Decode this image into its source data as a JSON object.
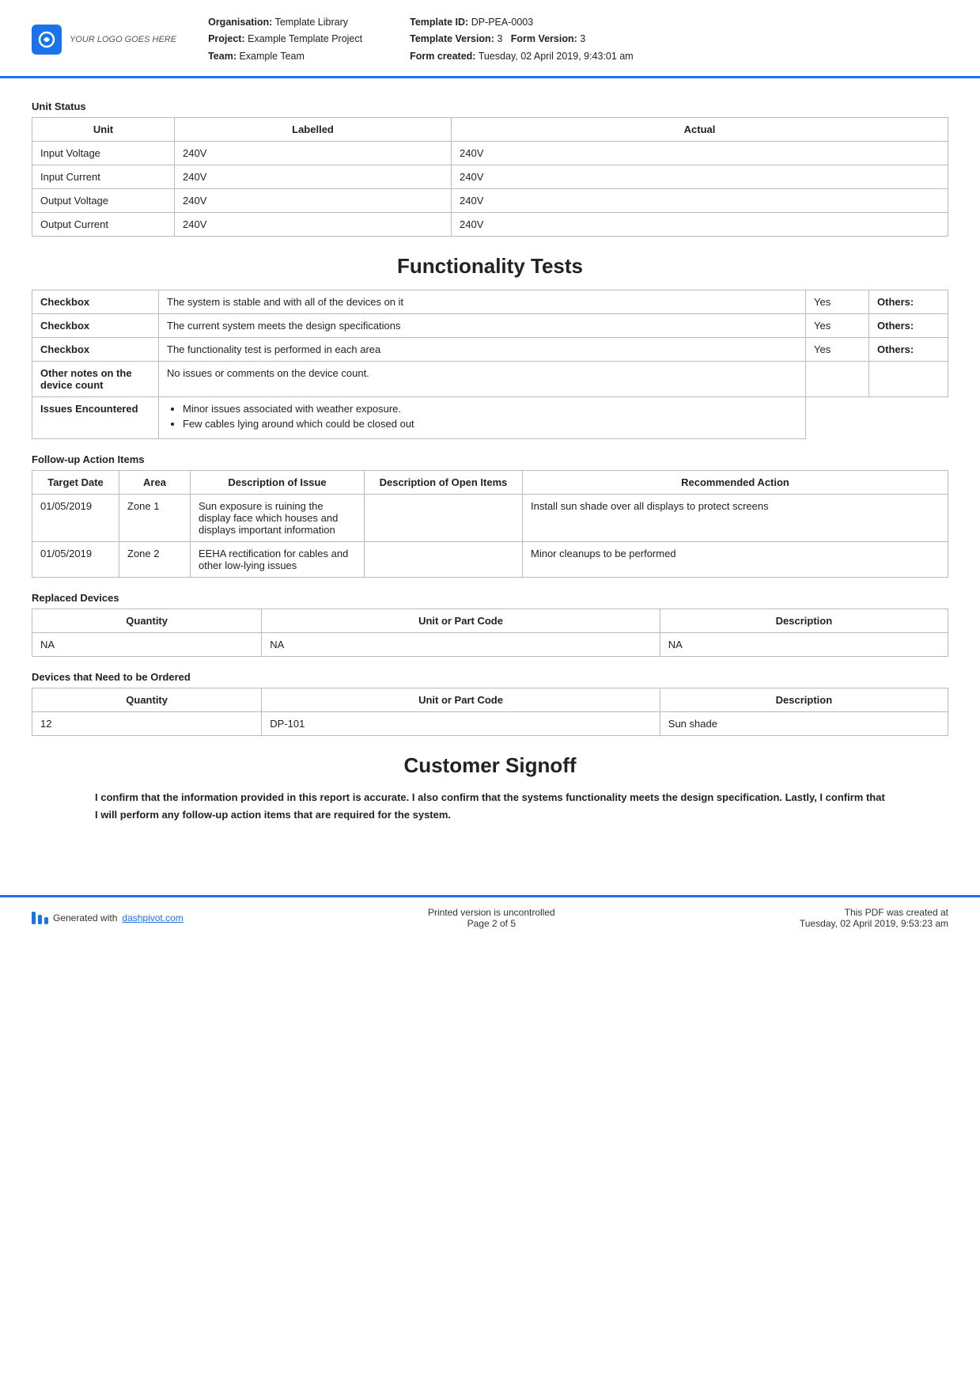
{
  "header": {
    "logo_text": "YOUR LOGO GOES HERE",
    "org_label": "Organisation:",
    "org_value": "Template Library",
    "project_label": "Project:",
    "project_value": "Example Template Project",
    "team_label": "Team:",
    "team_value": "Example Team",
    "template_id_label": "Template ID:",
    "template_id_value": "DP-PEA-0003",
    "template_version_label": "Template Version:",
    "template_version_value": "3",
    "form_version_label": "Form Version:",
    "form_version_value": "3",
    "form_created_label": "Form created:",
    "form_created_value": "Tuesday, 02 April 2019, 9:43:01 am"
  },
  "unit_status": {
    "section_label": "Unit Status",
    "columns": [
      "Unit",
      "Labelled",
      "Actual"
    ],
    "rows": [
      [
        "Input Voltage",
        "240V",
        "240V"
      ],
      [
        "Input Current",
        "240V",
        "240V"
      ],
      [
        "Output Voltage",
        "240V",
        "240V"
      ],
      [
        "Output Current",
        "240V",
        "240V"
      ]
    ]
  },
  "functionality_tests": {
    "heading": "Functionality Tests",
    "rows": [
      {
        "label": "Checkbox",
        "description": "The system is stable and with all of the devices on it",
        "value": "Yes",
        "others_label": "Others:"
      },
      {
        "label": "Checkbox",
        "description": "The current system meets the design specifications",
        "value": "Yes",
        "others_label": "Others:"
      },
      {
        "label": "Checkbox",
        "description": "The functionality test is performed in each area",
        "value": "Yes",
        "others_label": "Others:"
      },
      {
        "label": "Other notes on the device count",
        "description": "No issues or comments on the device count.",
        "value": "",
        "others_label": ""
      },
      {
        "label": "Issues Encountered",
        "description": "",
        "value": "",
        "others_label": "",
        "is_bullets": true,
        "bullets": [
          "Minor issues associated with weather exposure.",
          "Few cables lying around which could be closed out"
        ]
      }
    ]
  },
  "followup": {
    "section_label": "Follow-up Action Items",
    "columns": [
      "Target Date",
      "Area",
      "Description of Issue",
      "Description of Open Items",
      "Recommended Action"
    ],
    "rows": [
      {
        "target_date": "01/05/2019",
        "area": "Zone 1",
        "description": "Sun exposure is ruining the display face which houses and displays important information",
        "open_items": "",
        "recommended": "Install sun shade over all displays to protect screens"
      },
      {
        "target_date": "01/05/2019",
        "area": "Zone 2",
        "description": "EEHA rectification for cables and other low-lying issues",
        "open_items": "",
        "recommended": "Minor cleanups to be performed"
      }
    ]
  },
  "replaced_devices": {
    "section_label": "Replaced Devices",
    "columns": [
      "Quantity",
      "Unit or Part Code",
      "Description"
    ],
    "rows": [
      [
        "NA",
        "NA",
        "NA"
      ]
    ]
  },
  "devices_to_order": {
    "section_label": "Devices that Need to be Ordered",
    "columns": [
      "Quantity",
      "Unit or Part Code",
      "Description"
    ],
    "rows": [
      [
        "12",
        "DP-101",
        "Sun shade"
      ]
    ]
  },
  "customer_signoff": {
    "heading": "Customer Signoff",
    "text": "I confirm that the information provided in this report is accurate. I also confirm that the systems functionality meets the design specification. Lastly, I confirm that I will perform any follow-up action items that are required for the system."
  },
  "footer": {
    "generated_with": "Generated with",
    "dashpivot_link": "dashpivot.com",
    "uncontrolled": "Printed version is uncontrolled",
    "page": "Page 2 of 5",
    "pdf_created": "This PDF was created at",
    "timestamp": "Tuesday, 02 April 2019, 9:53:23 am"
  }
}
